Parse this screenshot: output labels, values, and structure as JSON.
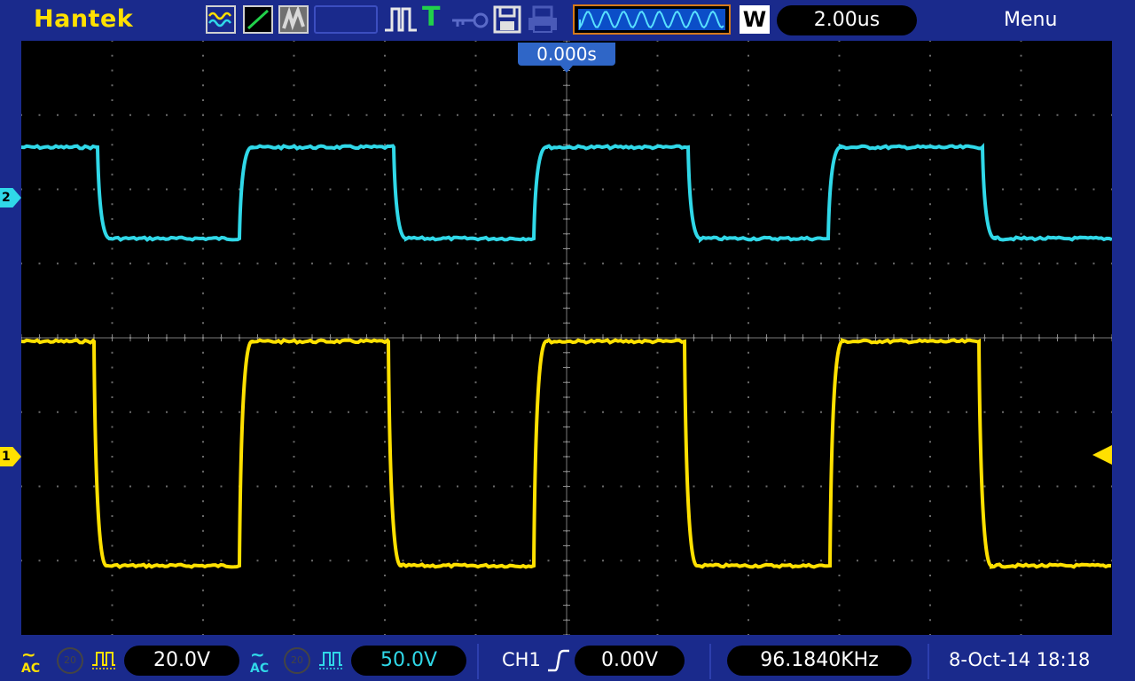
{
  "header": {
    "brand": "Hantek",
    "timebase": "2.00us",
    "menu_label": "Menu",
    "acquire_mode_label": "W",
    "trigger_icon_label": "T",
    "icons": [
      "wave-display-icon",
      "vector-line-icon",
      "persistence-icon",
      "pulse-icon",
      "trigger-icon",
      "key-lock-icon",
      "save-icon",
      "print-icon"
    ]
  },
  "screen": {
    "trigger_position": "0.000s",
    "ch1_marker": "1",
    "ch2_marker": "2",
    "ch1_color": "#ffe000",
    "ch2_color": "#30d8e8"
  },
  "footer": {
    "ch1_coupling": "AC",
    "ch1_bw_label": "20",
    "ch1_volts_div": "20.0V",
    "ch2_coupling": "AC",
    "ch2_bw_label": "20",
    "ch2_volts_div": "50.0V",
    "trigger_source": "CH1",
    "trigger_level": "0.00V",
    "frequency": "96.1840KHz",
    "datetime": "8-Oct-14 18:18"
  },
  "colors": {
    "background": "#1a2a8c",
    "screen": "#000000",
    "accent": "#2f66c7",
    "window_border": "#d77a1a"
  }
}
